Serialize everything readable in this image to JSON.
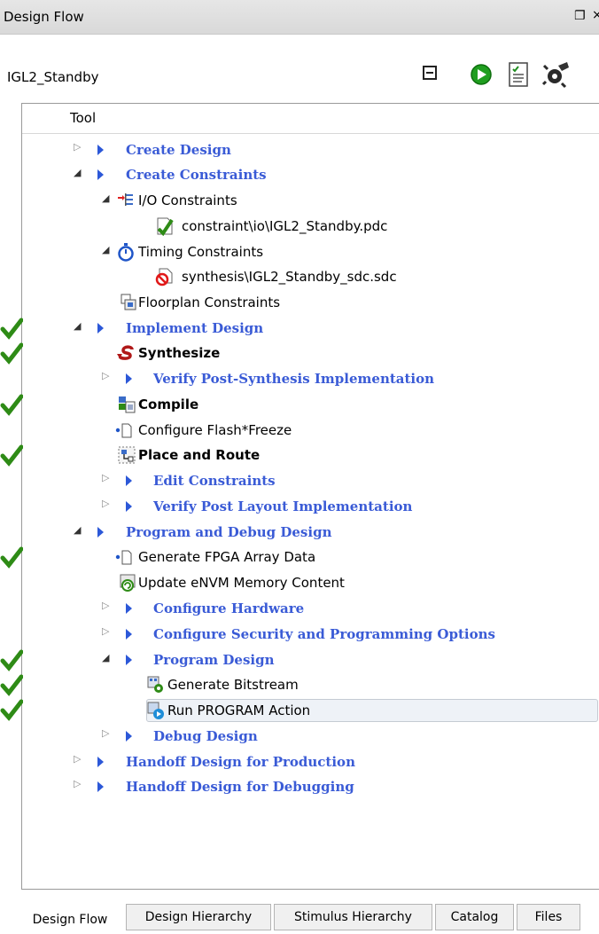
{
  "window": {
    "title": "Design Flow",
    "pin_icon": "restore-icon",
    "close_glyph": "×"
  },
  "project": {
    "name": "IGL2_Standby"
  },
  "toolbar": {
    "icons": [
      "collapse-all-icon",
      "run-icon",
      "report-icon",
      "options-gear-icon"
    ]
  },
  "tree": {
    "column_header": "Tool",
    "rows": [
      {
        "label": "Create Design",
        "style": "link",
        "checked": false
      },
      {
        "label": "Create Constraints",
        "style": "link",
        "checked": false
      },
      {
        "label": "I/O Constraints",
        "style": "normal",
        "checked": false
      },
      {
        "label": "constraint\\io\\IGL2_Standby.pdc",
        "style": "normal",
        "checked": false
      },
      {
        "label": "Timing Constraints",
        "style": "normal",
        "checked": false
      },
      {
        "label": "synthesis\\IGL2_Standby_sdc.sdc",
        "style": "normal",
        "checked": false
      },
      {
        "label": "Floorplan Constraints",
        "style": "normal",
        "checked": false
      },
      {
        "label": "Implement Design",
        "style": "link",
        "checked": true
      },
      {
        "label": "Synthesize",
        "style": "bold",
        "checked": true
      },
      {
        "label": "Verify Post-Synthesis Implementation",
        "style": "link",
        "checked": false
      },
      {
        "label": "Compile",
        "style": "bold",
        "checked": true
      },
      {
        "label": "Configure Flash*Freeze",
        "style": "normal",
        "checked": false
      },
      {
        "label": "Place and Route",
        "style": "bold",
        "checked": true
      },
      {
        "label": "Edit Constraints",
        "style": "link",
        "checked": false
      },
      {
        "label": "Verify Post Layout Implementation",
        "style": "link",
        "checked": false
      },
      {
        "label": "Program and Debug Design",
        "style": "link",
        "checked": false
      },
      {
        "label": "Generate FPGA Array Data",
        "style": "normal",
        "checked": true
      },
      {
        "label": "Update eNVM Memory Content",
        "style": "normal",
        "checked": false
      },
      {
        "label": "Configure Hardware",
        "style": "link",
        "checked": false
      },
      {
        "label": "Configure Security and Programming Options",
        "style": "link",
        "checked": false
      },
      {
        "label": "Program Design",
        "style": "link",
        "checked": true
      },
      {
        "label": "Generate Bitstream",
        "style": "normal",
        "checked": true
      },
      {
        "label": "Run PROGRAM Action",
        "style": "normal",
        "checked": true,
        "selected": true
      },
      {
        "label": "Debug Design",
        "style": "link",
        "checked": false
      },
      {
        "label": "Handoff Design for Production",
        "style": "link",
        "checked": false
      },
      {
        "label": "Handoff Design for Debugging",
        "style": "link",
        "checked": false
      }
    ]
  },
  "tabs": [
    {
      "label": "Design Flow",
      "active": true
    },
    {
      "label": "Design Hierarchy",
      "active": false
    },
    {
      "label": "Stimulus Hierarchy",
      "active": false
    },
    {
      "label": "Catalog",
      "active": false
    },
    {
      "label": "Files",
      "active": false
    }
  ],
  "colors": {
    "link": "#3a5bd6",
    "check": "#2e8b16",
    "selection_bg": "#eef2f7"
  }
}
